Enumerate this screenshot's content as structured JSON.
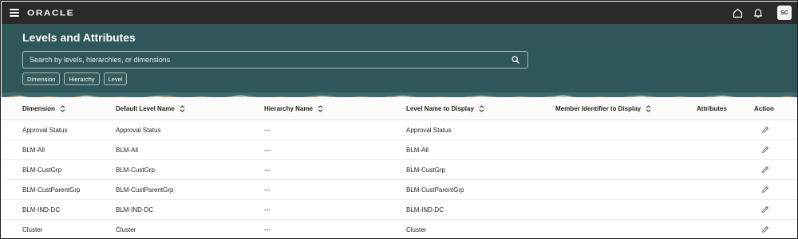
{
  "topbar": {
    "brand": "ORACLE",
    "avatar_initials": "SC",
    "icons": [
      "hamburger-menu-icon",
      "home-icon",
      "bell-icon"
    ]
  },
  "header": {
    "title": "Levels and Attributes",
    "search_placeholder": "Search by levels, hierarchies, or dimensions",
    "filters": [
      "Dimension",
      "Hierarchy",
      "Level"
    ]
  },
  "table": {
    "columns": [
      "Dimension",
      "Default Level Name",
      "Hierarchy Name",
      "Level Name to Display",
      "Member Identifier to Display",
      "Attributes",
      "Action"
    ],
    "rows": [
      {
        "dimension": "Approval Status",
        "default_level": "Approval Status",
        "hierarchy": "---",
        "level_display": "Approval Status"
      },
      {
        "dimension": "BLM-All",
        "default_level": "BLM-All",
        "hierarchy": "---",
        "level_display": "BLM-All"
      },
      {
        "dimension": "BLM-CustGrp",
        "default_level": "BLM-CustGrp",
        "hierarchy": "---",
        "level_display": "BLM-CustGrp"
      },
      {
        "dimension": "BLM-CustParentGrp",
        "default_level": "BLM-CustParentGrp",
        "hierarchy": "---",
        "level_display": "BLM-CustParentGrp"
      },
      {
        "dimension": "BLM-IND-DC",
        "default_level": "BLM-IND-DC",
        "hierarchy": "---",
        "level_display": "BLM-IND-DC"
      },
      {
        "dimension": "Cluster",
        "default_level": "Cluster",
        "hierarchy": "---",
        "level_display": "Cluster"
      }
    ]
  },
  "colors": {
    "topbar_bg": "#2b2a29",
    "banner_bg": "#2f5658",
    "text": "#1f1f1f"
  }
}
